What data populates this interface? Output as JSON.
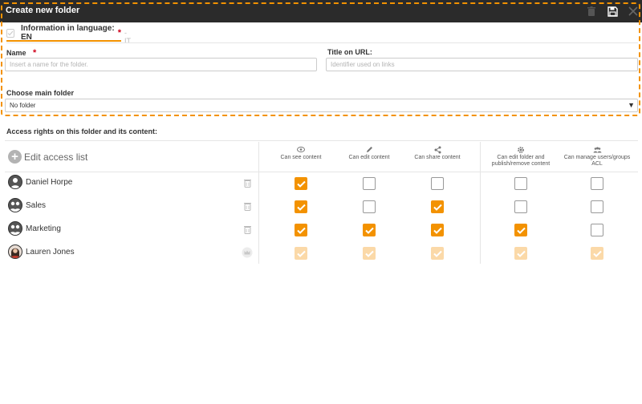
{
  "window": {
    "title": "Create new folder",
    "icons": [
      "trash-icon",
      "save-icon",
      "close-icon"
    ]
  },
  "language_tabs": {
    "active": {
      "label": "Information in language: EN",
      "required_mark": "*"
    },
    "other": "- IT"
  },
  "form": {
    "name": {
      "label": "Name",
      "required_mark": "*",
      "placeholder": "Insert a name for the folder.",
      "value": ""
    },
    "url_title": {
      "label": "Title on URL:",
      "placeholder": "Identifier used on links",
      "value": ""
    },
    "main_folder": {
      "label": "Choose main folder",
      "selected": "No folder",
      "caret": "▼"
    }
  },
  "access": {
    "section_title": "Access rights on this folder and its content:",
    "edit_list_label": "Edit access list",
    "columns": [
      {
        "label": "Can see content",
        "icon": "eye-icon"
      },
      {
        "label": "Can edit content",
        "icon": "pencil-icon"
      },
      {
        "label": "Can share content",
        "icon": "share-icon"
      },
      {
        "label": "Can edit folder and publish/remove content",
        "icon": "gear-icon"
      },
      {
        "label": "Can manage users/groups ACL",
        "icon": "users-icon"
      }
    ],
    "rows": [
      {
        "name": "Daniel Horpe",
        "type": "user",
        "action_icon": "trash-icon",
        "perms": [
          true,
          false,
          false,
          false,
          false
        ],
        "faded": false
      },
      {
        "name": "Sales",
        "type": "group",
        "action_icon": "trash-icon",
        "perms": [
          true,
          false,
          true,
          false,
          false
        ],
        "faded": false
      },
      {
        "name": "Marketing",
        "type": "group",
        "action_icon": "trash-icon",
        "perms": [
          true,
          true,
          true,
          true,
          false
        ],
        "faded": false
      },
      {
        "name": "Lauren Jones",
        "type": "owner",
        "action_icon": "crown-icon",
        "perms": [
          true,
          true,
          true,
          true,
          true
        ],
        "faded": true
      }
    ]
  },
  "colors": {
    "accent": "#f39200",
    "accent_faded": "#fbd9a8",
    "titlebar": "#2b2b2b",
    "required": "#d0021b"
  }
}
